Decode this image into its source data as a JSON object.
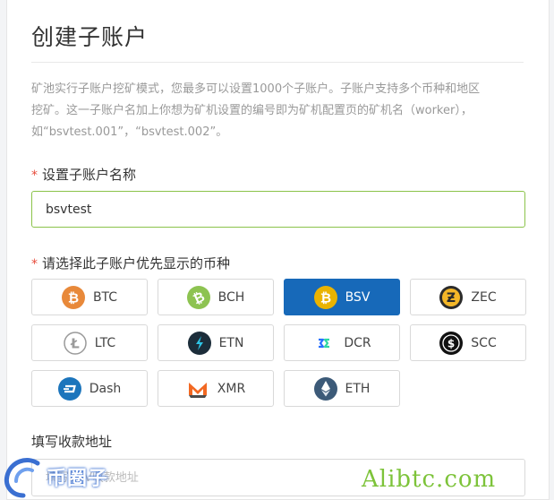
{
  "page": {
    "title": "创建子账户",
    "intro_line1": "矿池实行子账户挖矿模式，您最多可以设置1000个子账户。子账户支持多个币种和地区",
    "intro_line2": "挖矿。这一子账户名加上你想为矿机设置的编号即为矿机配置页的矿机名（worker），",
    "intro_line3": "如“bsvtest.001”，“bsvtest.002”。"
  },
  "name_field": {
    "required_mark": "*",
    "label": "设置子账户名称",
    "value": "bsvtest"
  },
  "coin_field": {
    "required_mark": "*",
    "label": "请选择此子账户优先显示的币种",
    "selected": "BSV",
    "coins": [
      {
        "label": "BTC",
        "icon": "bitcoin-icon",
        "color": "#e8893a"
      },
      {
        "label": "BCH",
        "icon": "bitcoin-cash-icon",
        "color": "#8dc351"
      },
      {
        "label": "BSV",
        "icon": "bitcoin-sv-icon",
        "color": "#eab300"
      },
      {
        "label": "ZEC",
        "icon": "zcash-icon",
        "color": "#2b2b2b"
      },
      {
        "label": "LTC",
        "icon": "litecoin-icon",
        "color": "#9a9a9a"
      },
      {
        "label": "ETN",
        "icon": "electroneum-icon",
        "color": "#1c2d3a"
      },
      {
        "label": "DCR",
        "icon": "decred-icon",
        "color": "#2970ff"
      },
      {
        "label": "SCC",
        "icon": "stakecube-icon",
        "color": "#111111"
      },
      {
        "label": "Dash",
        "icon": "dash-icon",
        "color": "#1c75bc"
      },
      {
        "label": "XMR",
        "icon": "monero-icon",
        "color": "#f26822"
      },
      {
        "label": "ETH",
        "icon": "ethereum-icon",
        "color": "#3c5a78"
      }
    ]
  },
  "address_field": {
    "label": "填写收款地址",
    "placeholder": "填写BSV收款地址"
  },
  "watermark": {
    "left_text": "币圈子",
    "right_text": "Alibtc.com"
  }
}
